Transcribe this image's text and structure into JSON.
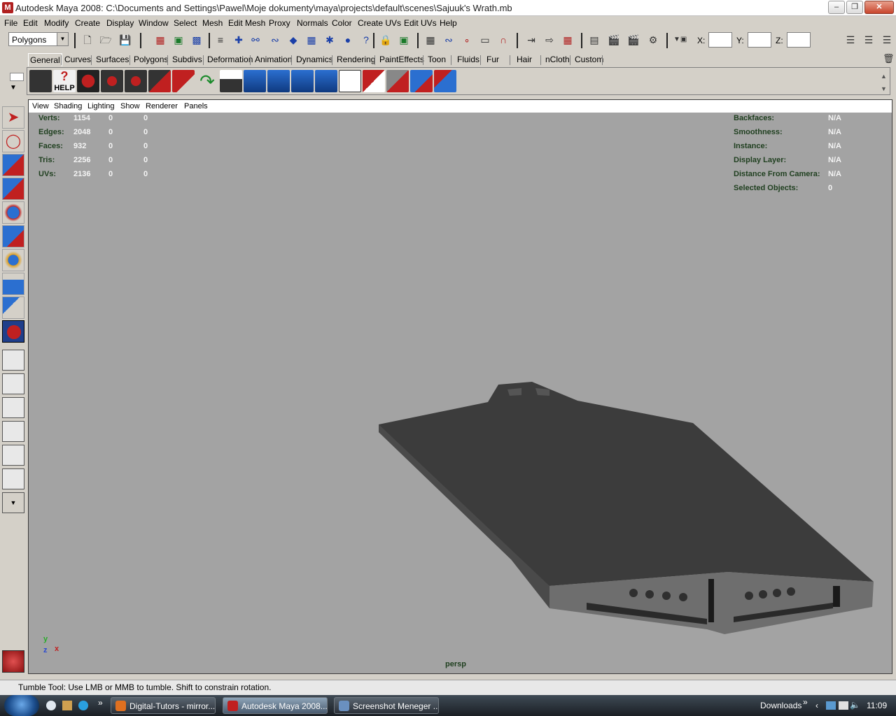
{
  "window": {
    "title": "Autodesk Maya 2008: C:\\Documents and Settings\\Pawel\\Moje dokumenty\\maya\\projects\\default\\scenes\\Sajuuk's Wrath.mb",
    "app_icon_glyph": "M"
  },
  "menubar": [
    "File",
    "Edit",
    "Modify",
    "Create",
    "Display",
    "Window",
    "Select",
    "Mesh",
    "Edit Mesh",
    "Proxy",
    "Normals",
    "Color",
    "Create UVs",
    "Edit UVs",
    "Help"
  ],
  "status_line": {
    "mode": "Polygons",
    "x_label": "X:",
    "y_label": "Y:",
    "z_label": "Z:"
  },
  "shelf_tabs": [
    "General",
    "Curves",
    "Surfaces",
    "Polygons",
    "Subdivs",
    "Deformation",
    "Animation",
    "Dynamics",
    "Rendering",
    "PaintEffects",
    "Toon",
    "Fluids",
    "Fur",
    "Hair",
    "nCloth",
    "Custom"
  ],
  "shelf": {
    "help_label": "HELP"
  },
  "panel_menu": [
    "View",
    "Shading",
    "Lighting",
    "Show",
    "Renderer",
    "Panels"
  ],
  "hud_left": [
    {
      "label": "Verts:",
      "v1": "1154",
      "v2": "0",
      "v3": "0"
    },
    {
      "label": "Edges:",
      "v1": "2048",
      "v2": "0",
      "v3": "0"
    },
    {
      "label": "Faces:",
      "v1": "932",
      "v2": "0",
      "v3": "0"
    },
    {
      "label": "Tris:",
      "v1": "2256",
      "v2": "0",
      "v3": "0"
    },
    {
      "label": "UVs:",
      "v1": "2136",
      "v2": "0",
      "v3": "0"
    }
  ],
  "hud_right": [
    {
      "label": "Backfaces:",
      "value": "N/A"
    },
    {
      "label": "Smoothness:",
      "value": "N/A"
    },
    {
      "label": "Instance:",
      "value": "N/A"
    },
    {
      "label": "Display Layer:",
      "value": "N/A"
    },
    {
      "label": "Distance From Camera:",
      "value": "N/A"
    },
    {
      "label": "Selected Objects:",
      "value": "0"
    }
  ],
  "viewport": {
    "camera": "persp",
    "axis_y": "y",
    "axis_z": "z",
    "axis_x": "x",
    "background_color": "#a3a3a3"
  },
  "helpline": "Tumble Tool: Use LMB or MMB to tumble. Shift to constrain rotation.",
  "taskbar": {
    "quicklaunch_more": "»",
    "buttons": [
      {
        "label": "Digital-Tutors - mirror...",
        "active": false
      },
      {
        "label": "Autodesk Maya 2008...",
        "active": true
      },
      {
        "label": "Screenshot Meneger ...",
        "active": false
      }
    ],
    "downloads": "Downloads",
    "tray_more": "»",
    "clock": "11:09"
  },
  "colors": {
    "accent": "#1f3e8a",
    "hud_label": "#1f3f1f",
    "model_top": "#3c3c3c",
    "model_side": "#6e6e6e"
  }
}
